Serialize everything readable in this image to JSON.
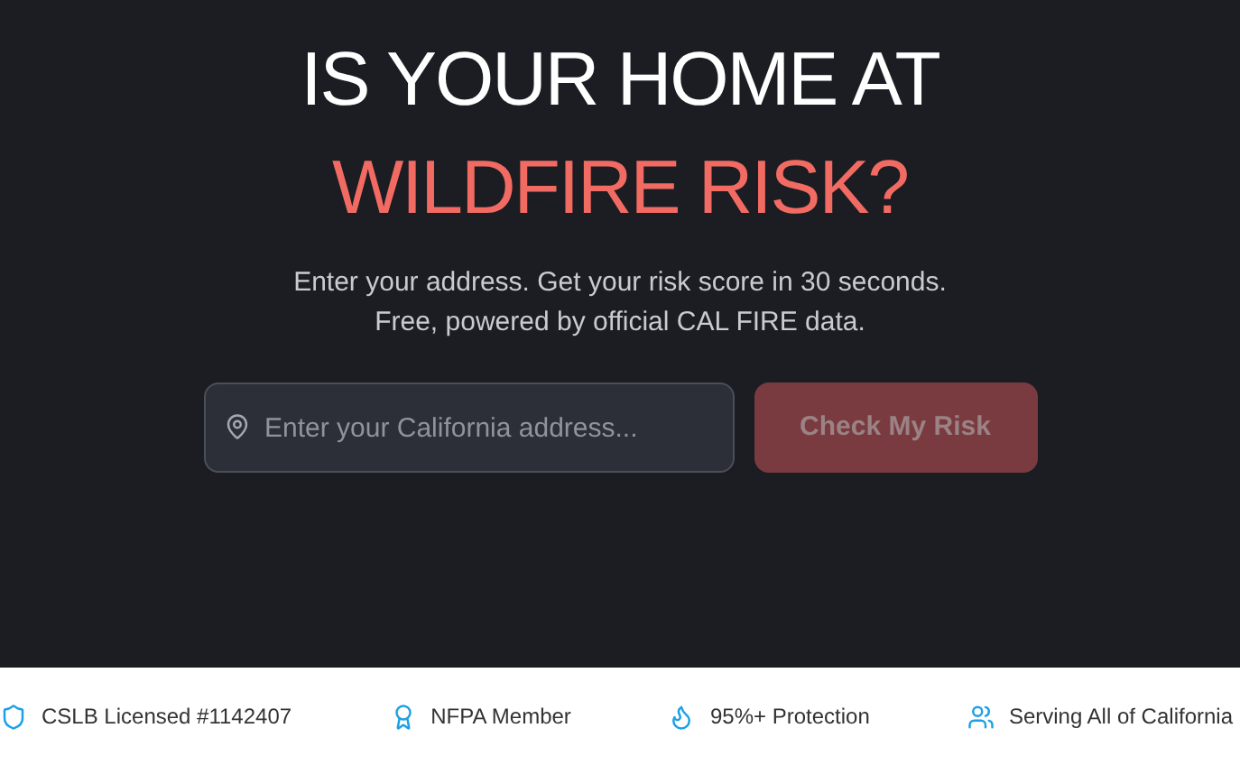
{
  "hero": {
    "title_line_1": "IS YOUR HOME AT",
    "title_line_2": "WILDFIRE RISK?",
    "subtitle_line_1": "Enter your address. Get your risk score in 30 seconds.",
    "subtitle_line_2": "Free, powered by official CAL FIRE data."
  },
  "search": {
    "placeholder": "Enter your California address...",
    "button": {
      "label": "Check My Risk",
      "disabled": true
    }
  },
  "trust_bar": [
    {
      "kind": "shield",
      "label": "CSLB Licensed #1142407"
    },
    {
      "kind": "award",
      "label": "NFPA Member"
    },
    {
      "kind": "flame",
      "label": "95%+ Protection"
    },
    {
      "kind": "users",
      "label": "Serving All of California"
    }
  ]
}
